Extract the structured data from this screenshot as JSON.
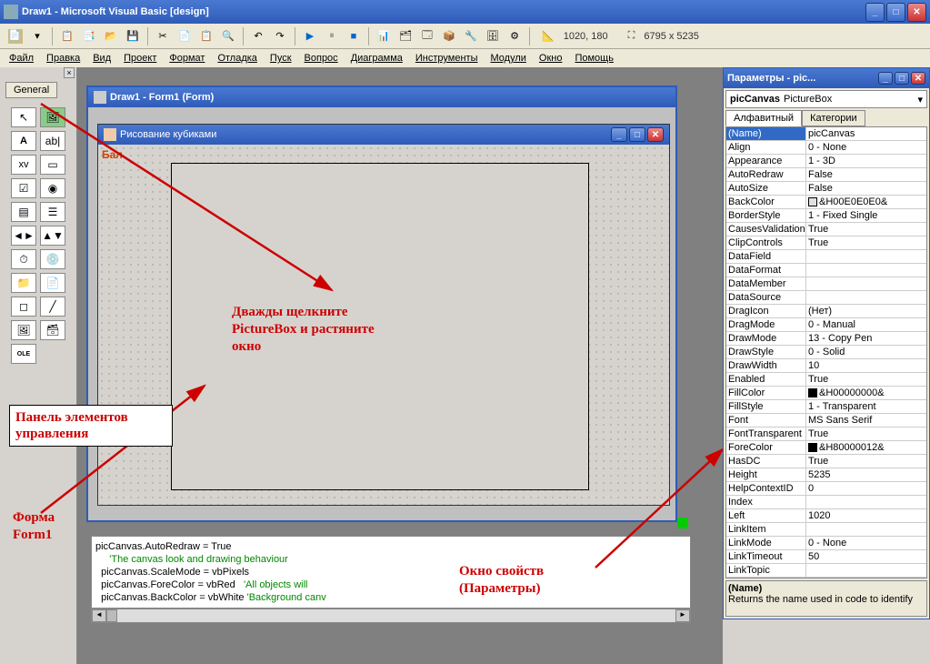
{
  "title": "Draw1 - Microsoft Visual Basic [design]",
  "coords": "1020, 180",
  "size": "6795 x 5235",
  "menu": [
    "Файл",
    "Правка",
    "Вид",
    "Проект",
    "Формат",
    "Отладка",
    "Пуск",
    "Вопрос",
    "Диаграмма",
    "Инструменты",
    "Модули",
    "Окно",
    "Помощь"
  ],
  "toolbox_tab": "General",
  "form_designer_title": "Draw1 - Form1 (Form)",
  "inner_form_title": "Рисование кубиками",
  "annot1": "Дважды щелкните\nPictureBox и растяните\nокно",
  "annot2": "Панель элементов\nуправления",
  "annot3": "Форма\nForm1",
  "annot4": "Окно свойств\n(Параметры)",
  "code_line1a": "picCanvas.AutoRedraw = True",
  "code_line2": "     'The canvas look and drawing behaviour",
  "code_line3": "  picCanvas.ScaleMode = vbPixels",
  "code_line4a": "  picCanvas.ForeColor = vbRed   ",
  "code_line4b": "'All objects will",
  "code_line5a": "  picCanvas.BackColor = vbWhite ",
  "code_line5b": "'Background canv",
  "prop_title": "Параметры - pic...",
  "prop_combo_name": "picCanvas",
  "prop_combo_type": "PictureBox",
  "prop_tab1": "Алфавитный",
  "prop_tab2": "Категории",
  "props": [
    {
      "k": "(Name)",
      "v": "picCanvas",
      "sel": true
    },
    {
      "k": "Align",
      "v": "0 - None"
    },
    {
      "k": "Appearance",
      "v": "1 - 3D"
    },
    {
      "k": "AutoRedraw",
      "v": "False"
    },
    {
      "k": "AutoSize",
      "v": "False"
    },
    {
      "k": "BackColor",
      "v": "&H00E0E0E0&",
      "color": "#e0e0e0"
    },
    {
      "k": "BorderStyle",
      "v": "1 - Fixed Single"
    },
    {
      "k": "CausesValidation",
      "v": "True"
    },
    {
      "k": "ClipControls",
      "v": "True"
    },
    {
      "k": "DataField",
      "v": ""
    },
    {
      "k": "DataFormat",
      "v": ""
    },
    {
      "k": "DataMember",
      "v": ""
    },
    {
      "k": "DataSource",
      "v": ""
    },
    {
      "k": "DragIcon",
      "v": "(Нет)"
    },
    {
      "k": "DragMode",
      "v": "0 - Manual"
    },
    {
      "k": "DrawMode",
      "v": "13 - Copy Pen"
    },
    {
      "k": "DrawStyle",
      "v": "0 - Solid"
    },
    {
      "k": "DrawWidth",
      "v": "10"
    },
    {
      "k": "Enabled",
      "v": "True"
    },
    {
      "k": "FillColor",
      "v": "&H00000000&",
      "color": "#000"
    },
    {
      "k": "FillStyle",
      "v": "1 - Transparent"
    },
    {
      "k": "Font",
      "v": "MS Sans Serif"
    },
    {
      "k": "FontTransparent",
      "v": "True"
    },
    {
      "k": "ForeColor",
      "v": "&H80000012&",
      "color": "#000"
    },
    {
      "k": "HasDC",
      "v": "True"
    },
    {
      "k": "Height",
      "v": "5235"
    },
    {
      "k": "HelpContextID",
      "v": "0"
    },
    {
      "k": "Index",
      "v": ""
    },
    {
      "k": "Left",
      "v": "1020"
    },
    {
      "k": "LinkItem",
      "v": ""
    },
    {
      "k": "LinkMode",
      "v": "0 - None"
    },
    {
      "k": "LinkTimeout",
      "v": "50"
    },
    {
      "k": "LinkTopic",
      "v": ""
    }
  ],
  "desc_title": "(Name)",
  "desc_text": "Returns the name used in code to identify"
}
